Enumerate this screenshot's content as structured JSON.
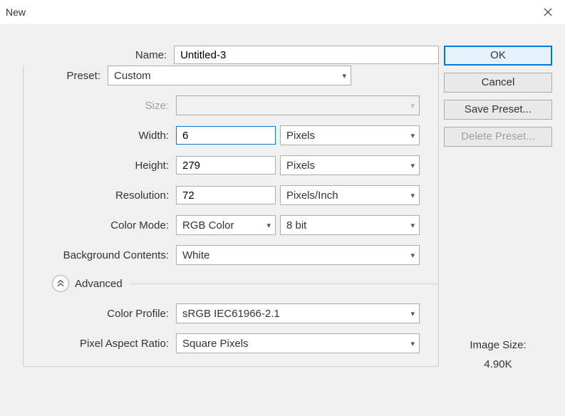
{
  "window": {
    "title": "New"
  },
  "labels": {
    "name": "Name:",
    "preset": "Preset:",
    "size": "Size:",
    "width": "Width:",
    "height": "Height:",
    "resolution": "Resolution:",
    "colorMode": "Color Mode:",
    "bgContents": "Background Contents:",
    "advanced": "Advanced",
    "colorProfile": "Color Profile:",
    "pixelAspect": "Pixel Aspect Ratio:"
  },
  "fields": {
    "name": "Untitled-3",
    "preset": "Custom",
    "size": "",
    "width": "6",
    "widthUnit": "Pixels",
    "height": "279",
    "heightUnit": "Pixels",
    "resolution": "72",
    "resolutionUnit": "Pixels/Inch",
    "colorMode": "RGB Color",
    "bitDepth": "8 bit",
    "bgContents": "White",
    "colorProfile": "sRGB IEC61966-2.1",
    "pixelAspect": "Square Pixels"
  },
  "buttons": {
    "ok": "OK",
    "cancel": "Cancel",
    "savePreset": "Save Preset...",
    "deletePreset": "Delete Preset..."
  },
  "info": {
    "imageSizeLabel": "Image Size:",
    "imageSizeValue": "4.90K"
  }
}
